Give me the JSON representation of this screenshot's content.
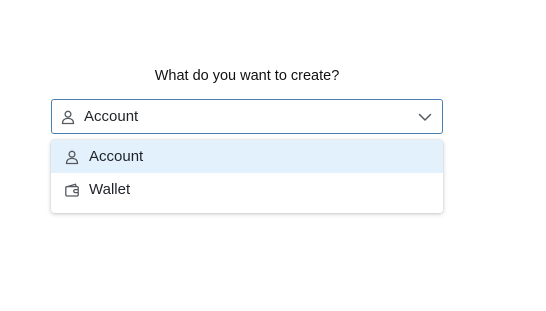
{
  "form": {
    "question": "What do you want to create?",
    "select": {
      "value": "Account",
      "value_icon": "person-icon",
      "options": [
        {
          "label": "Account",
          "icon": "person-icon",
          "selected": true
        },
        {
          "label": "Wallet",
          "icon": "wallet-icon",
          "selected": false
        }
      ]
    }
  },
  "colors": {
    "select_border": "#4a7fb0",
    "highlight": "#e3f1fc",
    "text": "#1f2328"
  }
}
